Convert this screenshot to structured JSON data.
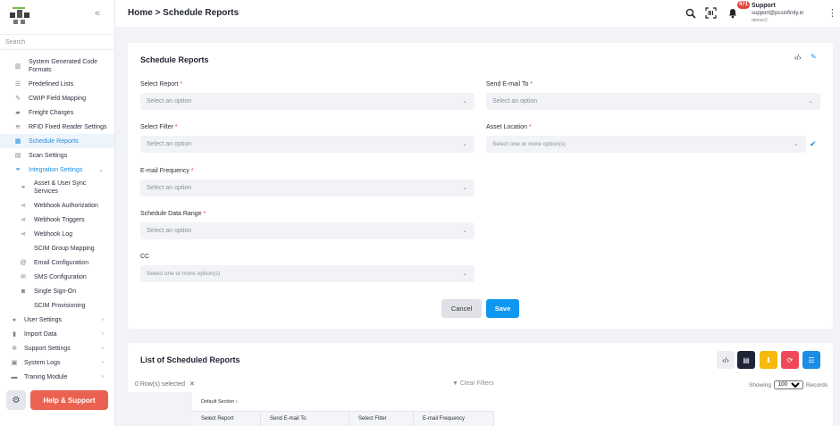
{
  "sidebar": {
    "search_placeholder": "Search",
    "items": [
      {
        "label": "System Generated Code Formats",
        "icon": "barcode-icon"
      },
      {
        "label": "Predefined Lists",
        "icon": "list-icon"
      },
      {
        "label": "CWIP Field Mapping",
        "icon": "pencil-icon"
      },
      {
        "label": "Freight Charges",
        "icon": "truck-icon"
      },
      {
        "label": "RFID Fixed Reader Settings",
        "icon": "wifi-icon"
      },
      {
        "label": "Schedule Reports",
        "icon": "calendar-icon"
      },
      {
        "label": "Scan Settings",
        "icon": "scan-icon"
      },
      {
        "label": "Integration Settings",
        "icon": "link-icon"
      }
    ],
    "sub_items": [
      {
        "label": "Asset & User Sync Services",
        "icon": "link-icon"
      },
      {
        "label": "Webhook Authorization",
        "icon": "share-icon"
      },
      {
        "label": "Webhook Triggers",
        "icon": "share-icon"
      },
      {
        "label": "Webhook Log",
        "icon": "share-icon"
      },
      {
        "label": "SCIM Group Mapping",
        "icon": ""
      },
      {
        "label": "Email Configuration",
        "icon": "at-icon"
      },
      {
        "label": "SMS Configuration",
        "icon": "mail-icon"
      },
      {
        "label": "Single Sign-On",
        "icon": "user-icon"
      },
      {
        "label": "SCIM Provisioning",
        "icon": ""
      }
    ],
    "top_items": [
      {
        "label": "User Settings",
        "icon": "users-icon"
      },
      {
        "label": "Import Data",
        "icon": "file-icon"
      },
      {
        "label": "Support Settings",
        "icon": "cogs-icon"
      },
      {
        "label": "System Logs",
        "icon": "log-icon"
      },
      {
        "label": "Traning Module",
        "icon": "book-icon"
      }
    ],
    "help_label": "Help & Support"
  },
  "header": {
    "breadcrumb": "Home > Schedule Reports",
    "notif_count": "471",
    "user_name": "Support",
    "user_email": "support@pcsinfinity.in",
    "user_sub": "demov2"
  },
  "form": {
    "title": "Schedule Reports",
    "select_report": {
      "label": "Select Report",
      "placeholder": "Select an option"
    },
    "send_email_to": {
      "label": "Send E-mail To",
      "placeholder": "Select an option"
    },
    "select_filter": {
      "label": "Select Filter",
      "placeholder": "Select an option"
    },
    "asset_location": {
      "label": "Asset Location",
      "placeholder": "Select one or more option(s)"
    },
    "email_frequency": {
      "label": "E-mail Frequency",
      "placeholder": "Select an option"
    },
    "schedule_data_range": {
      "label": "Schedule Data Range",
      "placeholder": "Select an option"
    },
    "cc": {
      "label": "CC",
      "placeholder": "Select one or more option(s)"
    },
    "required_mark": "*",
    "cancel_label": "Cancel",
    "save_label": "Save"
  },
  "list": {
    "title": "List of Scheduled Reports",
    "rows_selected": "0 Row(s) selected",
    "clear_filters": "Clear Filters",
    "showing_label": "Showing",
    "page_size": "100",
    "records_label": "Records",
    "section_label": "Default Section",
    "columns": [
      "Select Report",
      "Send E-mail To",
      "Select Filter",
      "E-mail Frequency"
    ]
  },
  "colors": {
    "accent": "#1d8ce0",
    "save": "#0d97f0",
    "help": "#ec6250",
    "toolbar_dark": "#1e2436",
    "toolbar_yellow": "#f6b90c",
    "toolbar_red": "#ee4a5a",
    "toolbar_blue": "#1c8de4"
  }
}
